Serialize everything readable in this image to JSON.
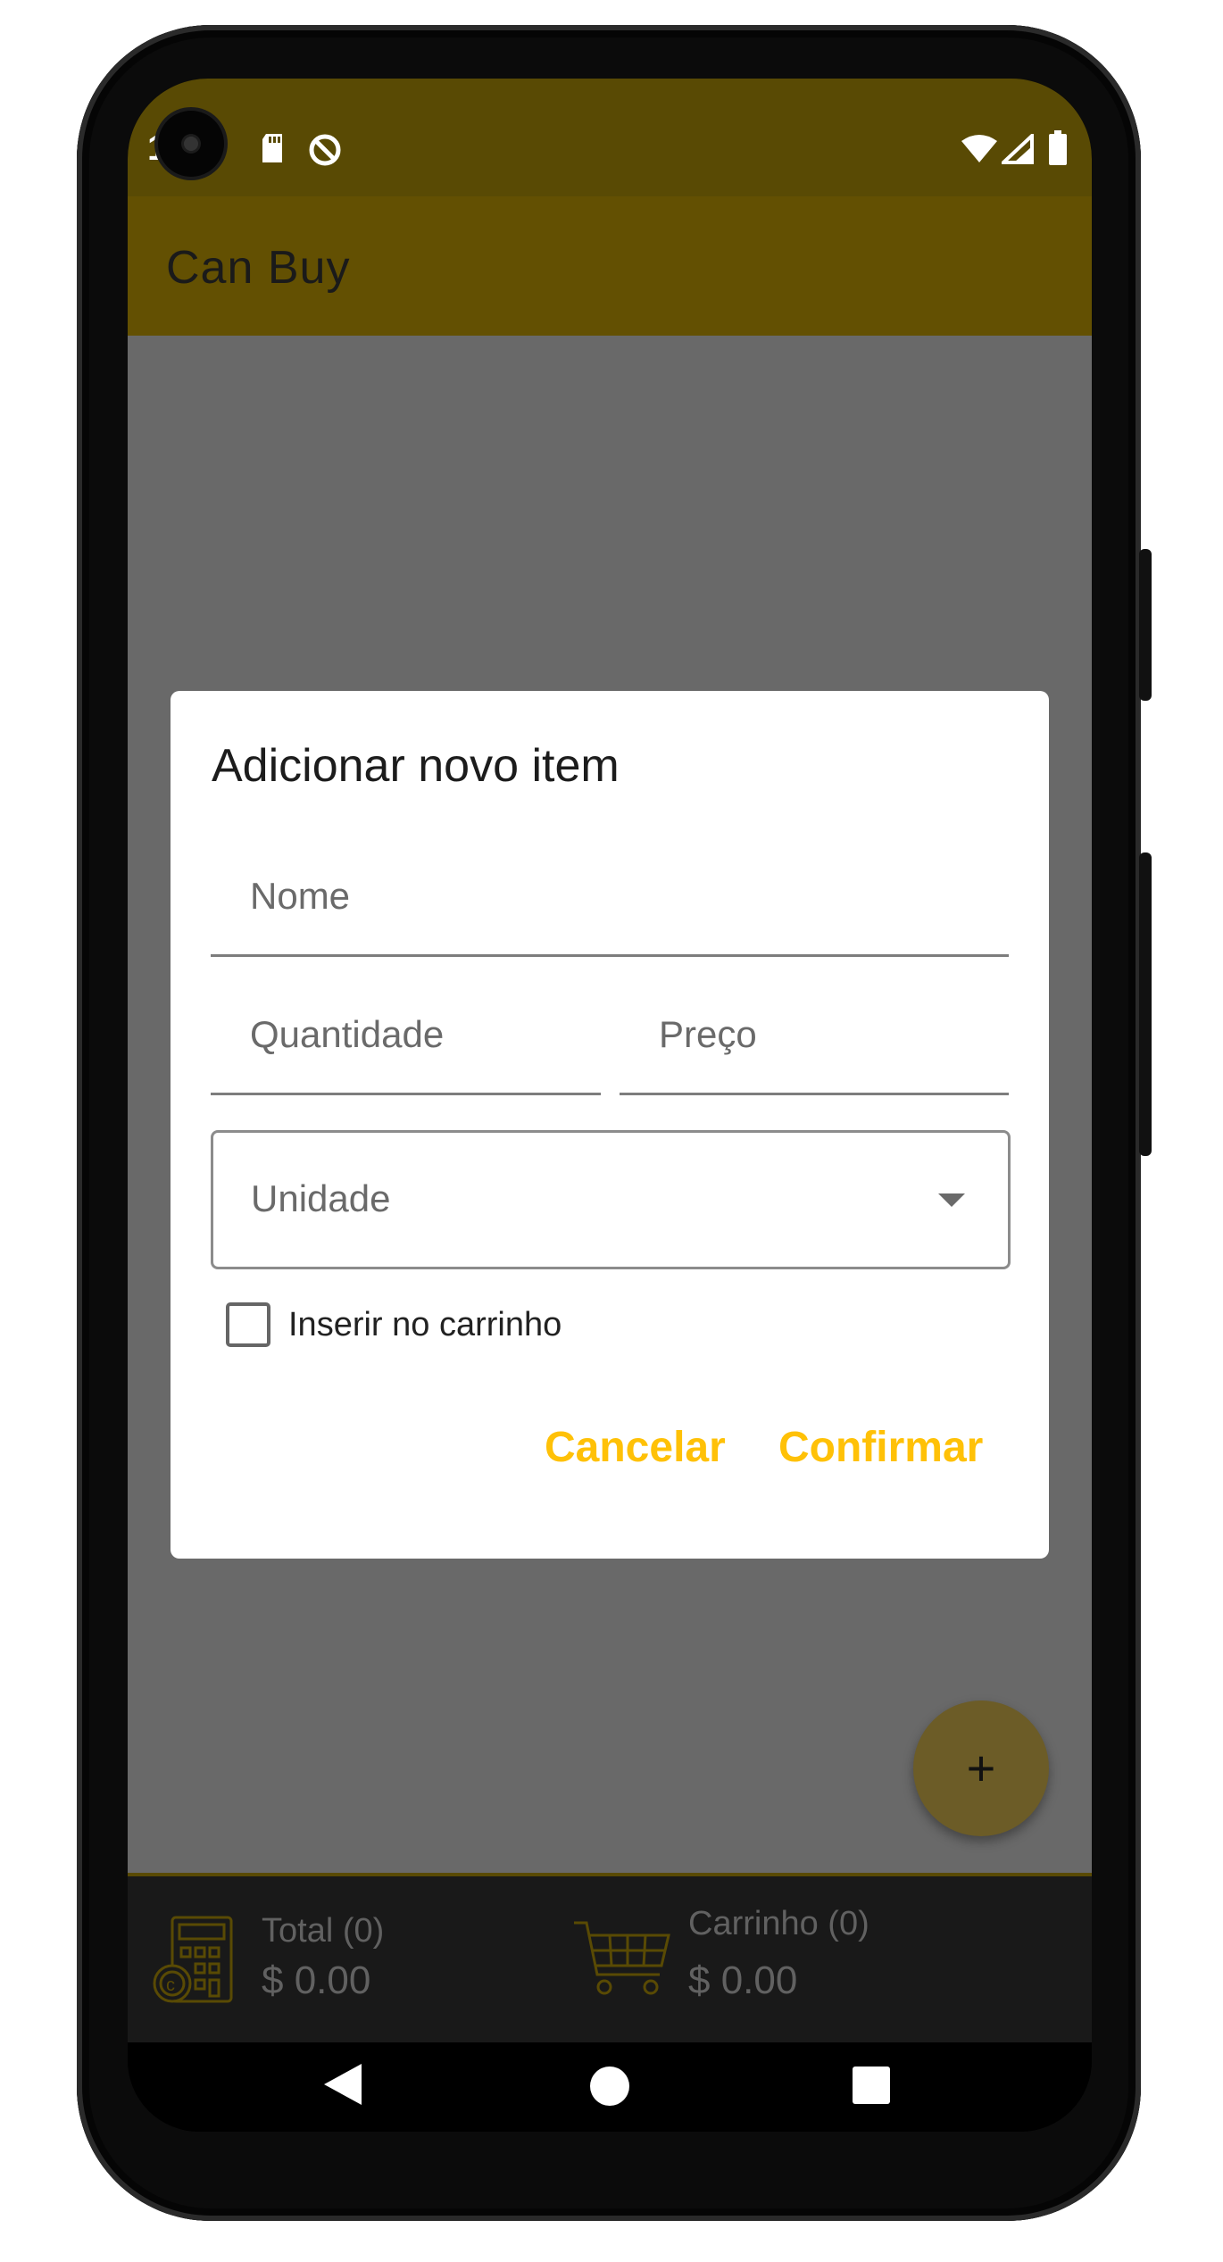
{
  "status_bar": {
    "time": "1 3",
    "icons": [
      "sd-card-icon",
      "data-saver-icon",
      "wifi-icon",
      "cell-signal-icon",
      "battery-icon"
    ]
  },
  "app_bar": {
    "title": "Can Buy"
  },
  "dialog": {
    "title": "Adicionar novo item",
    "name_placeholder": "Nome",
    "quantity_placeholder": "Quantidade",
    "price_placeholder": "Preço",
    "unit_placeholder": "Unidade",
    "add_to_cart_label": "Inserir no carrinho",
    "add_to_cart_checked": false,
    "cancel_label": "Cancelar",
    "confirm_label": "Confirmar"
  },
  "fab": {
    "label": "+"
  },
  "summary": {
    "total_label": "Total (0)",
    "total_value": "$ 0.00",
    "cart_label": "Carrinho (0)",
    "cart_value": "$ 0.00"
  },
  "nav": {
    "icons": [
      "back-icon",
      "home-icon",
      "recents-icon"
    ]
  },
  "colors": {
    "accent": "#ffc107",
    "app_bar": "#635002",
    "status_bar": "#594a04",
    "scrim": "#696969",
    "summary_bar": "#191919"
  }
}
